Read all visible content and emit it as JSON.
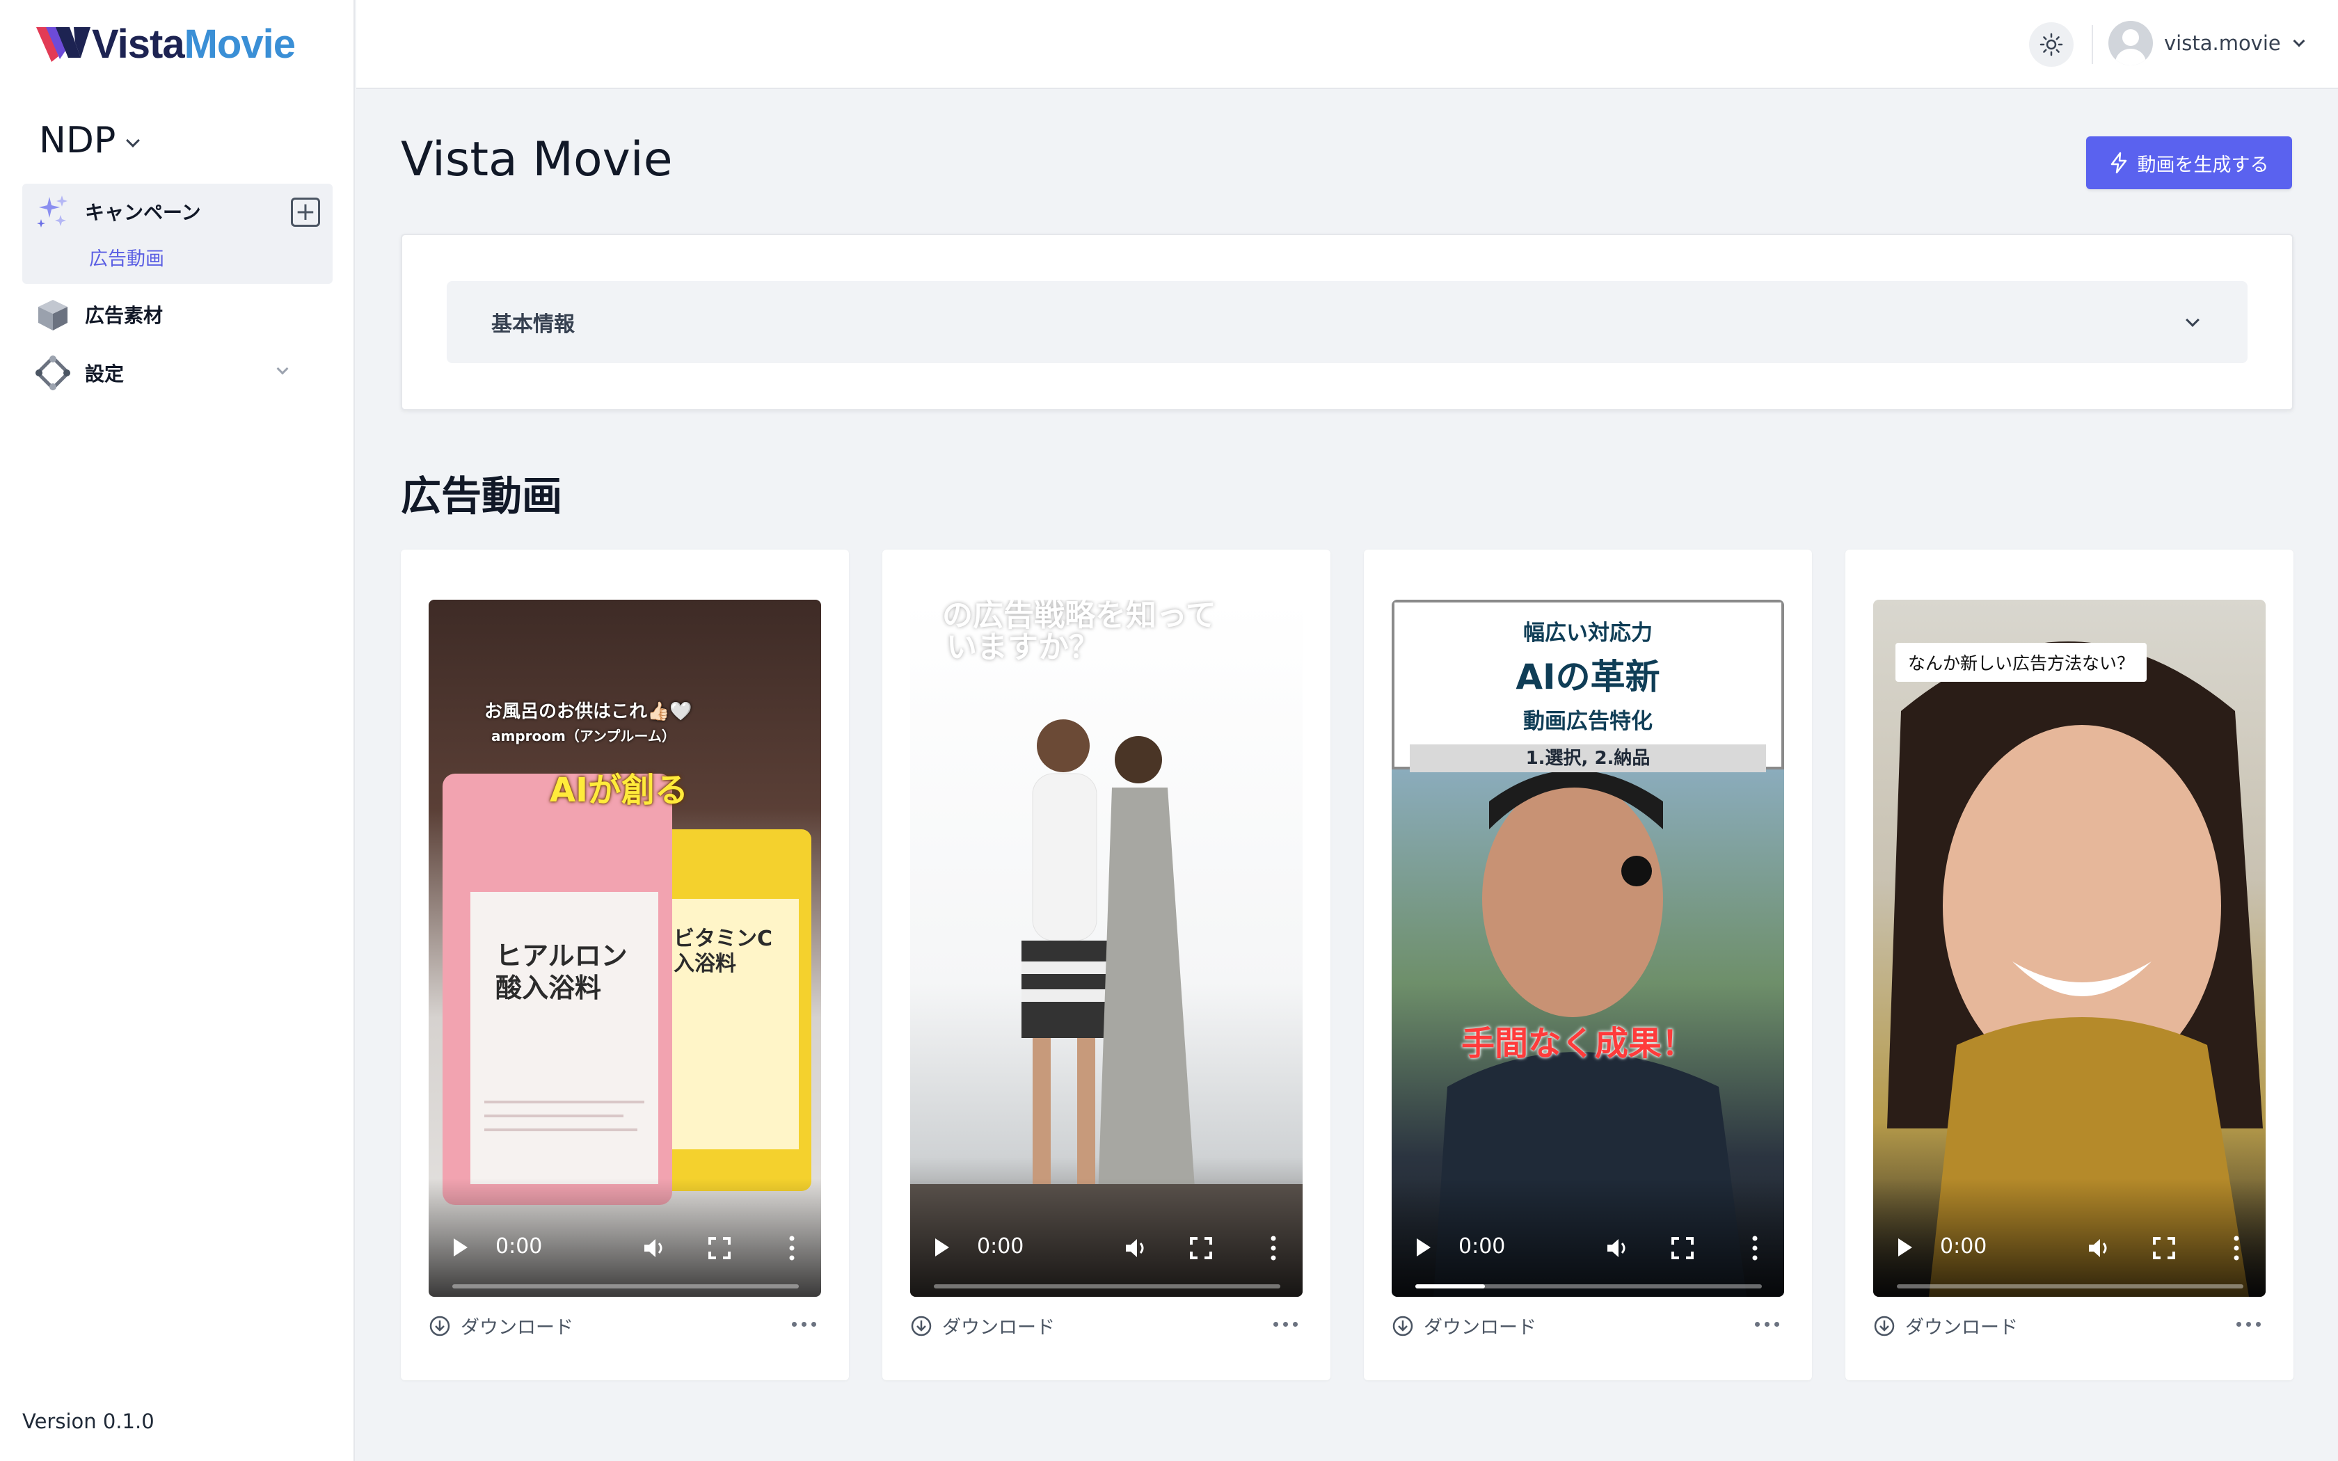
{
  "brand": {
    "name_part1": "Vista",
    "name_part2": "Movie"
  },
  "sidebar": {
    "org_name": "NDP",
    "nav": [
      {
        "label": "キャンペーン",
        "icon": "sparkles-icon"
      },
      {
        "label": "広告素材",
        "icon": "cube-icon"
      },
      {
        "label": "設定",
        "icon": "settings-icon"
      }
    ],
    "sub_item": "広告動画",
    "version": "Version 0.1.0"
  },
  "topbar": {
    "user_name": "vista.movie"
  },
  "main": {
    "title": "Vista Movie",
    "generate_button": "動画を生成する",
    "basic_info_label": "基本情報",
    "section_title": "広告動画"
  },
  "cards": [
    {
      "time": "0:00",
      "progress": 0,
      "download": "ダウンロード",
      "overlay": {
        "top1": "お風呂のお供はこれ👍🏻🤍",
        "top2": "amproom（アンプルーム）",
        "headline": "AIが創る",
        "pack_left": "ヒアルロン酸入浴料",
        "pack_right": "ビタミンC入浴料"
      }
    },
    {
      "time": "0:00",
      "progress": 0,
      "download": "ダウンロード",
      "overlay": {
        "line1": "の広告戦略を知って",
        "line2": "いますか？"
      }
    },
    {
      "time": "0:00",
      "progress": 0.2,
      "download": "ダウンロード",
      "overlay": {
        "line1": "幅広い対応力",
        "line2": "AIの革新",
        "line3": "動画広告特化",
        "line4": "1.選択, 2.納品",
        "caption": "手間なく成果！"
      }
    },
    {
      "time": "0:00",
      "progress": 0,
      "download": "ダウンロード",
      "overlay": {
        "bubble": "なんか新しい広告方法ない？"
      }
    }
  ],
  "colors": {
    "accent": "#5a62ef",
    "link": "#5b5fe3",
    "logo_dark": "#1d2352",
    "logo_blue": "#3a8fd6"
  }
}
